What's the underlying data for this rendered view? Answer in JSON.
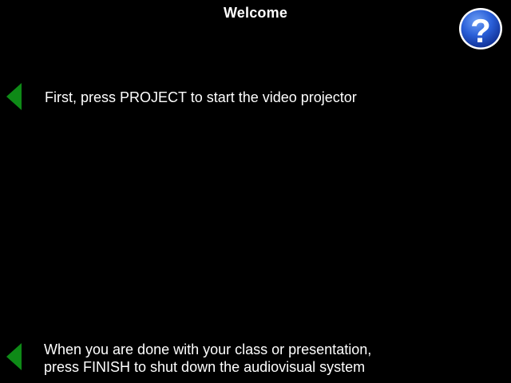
{
  "header": {
    "title": "Welcome"
  },
  "help": {
    "icon": "help-question-icon",
    "glyph": "?",
    "color": "#1a4fc8"
  },
  "steps": [
    {
      "icon": "green-left-arrow-icon",
      "text": "First, press PROJECT to start the video projector"
    },
    {
      "icon": "green-left-arrow-icon",
      "lines": [
        "When you are done with your class or presentation,",
        "press FINISH to shut down the audiovisual system"
      ]
    }
  ],
  "colors": {
    "background": "#000000",
    "text": "#ffffff",
    "arrow": "#0e8a17"
  }
}
